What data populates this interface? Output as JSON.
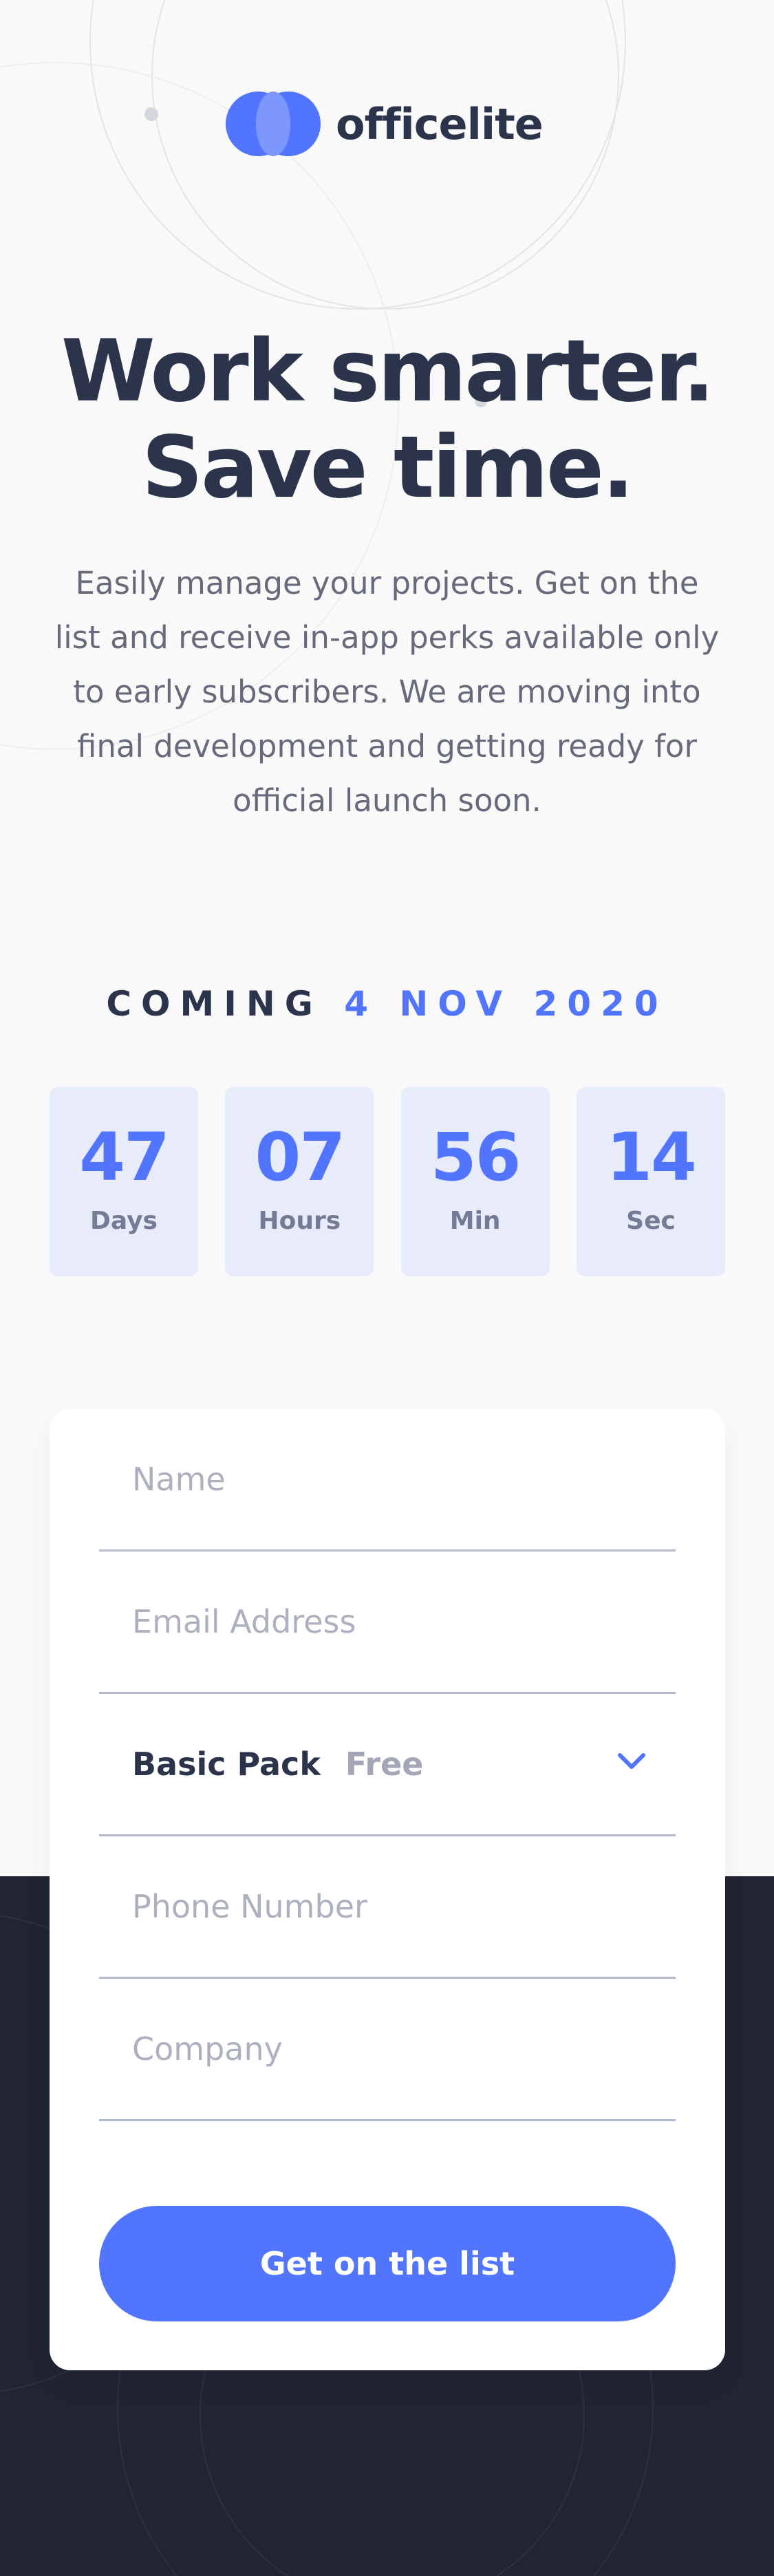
{
  "brand": {
    "name": "officelite",
    "colors": {
      "primary": "#5175FF",
      "dark": "#2C344B",
      "footer": "#212533"
    }
  },
  "hero": {
    "title_line1": "Work smarter.",
    "title_line2": "Save time.",
    "description": "Easily manage your projects. Get on the list and receive in-app perks available only to early subscribers. We are moving into final development and getting ready for official launch soon."
  },
  "countdown": {
    "coming_label": "COMING",
    "date": "4 NOV 2020",
    "units": [
      {
        "value": "47",
        "label": "Days"
      },
      {
        "value": "07",
        "label": "Hours"
      },
      {
        "value": "56",
        "label": "Min"
      },
      {
        "value": "14",
        "label": "Sec"
      }
    ]
  },
  "form": {
    "name_placeholder": "Name",
    "email_placeholder": "Email Address",
    "plan": {
      "selected": "Basic Pack",
      "price": "Free",
      "icon": "chevron-down-icon"
    },
    "phone_placeholder": "Phone Number",
    "company_placeholder": "Company",
    "submit_label": "Get on the list"
  }
}
